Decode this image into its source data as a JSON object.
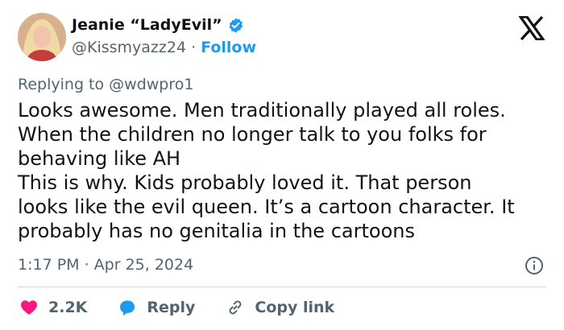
{
  "author": {
    "display_name": "Jeanie “LadyEvil”",
    "handle": "@Kissmyazz24",
    "separator": "·",
    "follow_label": "Follow"
  },
  "reply_context": "Replying to @wdwpro1",
  "tweet_text": "Looks awesome. Men traditionally played all roles.\nWhen the children no longer talk to you folks for\nbehaving like AH\nThis is why. Kids probably loved it. That person\nlooks like the evil queen. It’s a cartoon character. It\nprobably has no genitalia in the cartoons",
  "timestamp": "1:17 PM · Apr 25, 2024",
  "actions": {
    "like_count": "2.2K",
    "reply_label": "Reply",
    "copy_link_label": "Copy link"
  },
  "colors": {
    "accent": "#1d9bf0",
    "like": "#f91880",
    "muted": "#536471",
    "text": "#0f1419"
  },
  "icons": [
    "verified-badge-icon",
    "x-logo-icon",
    "info-icon",
    "heart-icon",
    "reply-bubble-icon",
    "link-icon"
  ]
}
